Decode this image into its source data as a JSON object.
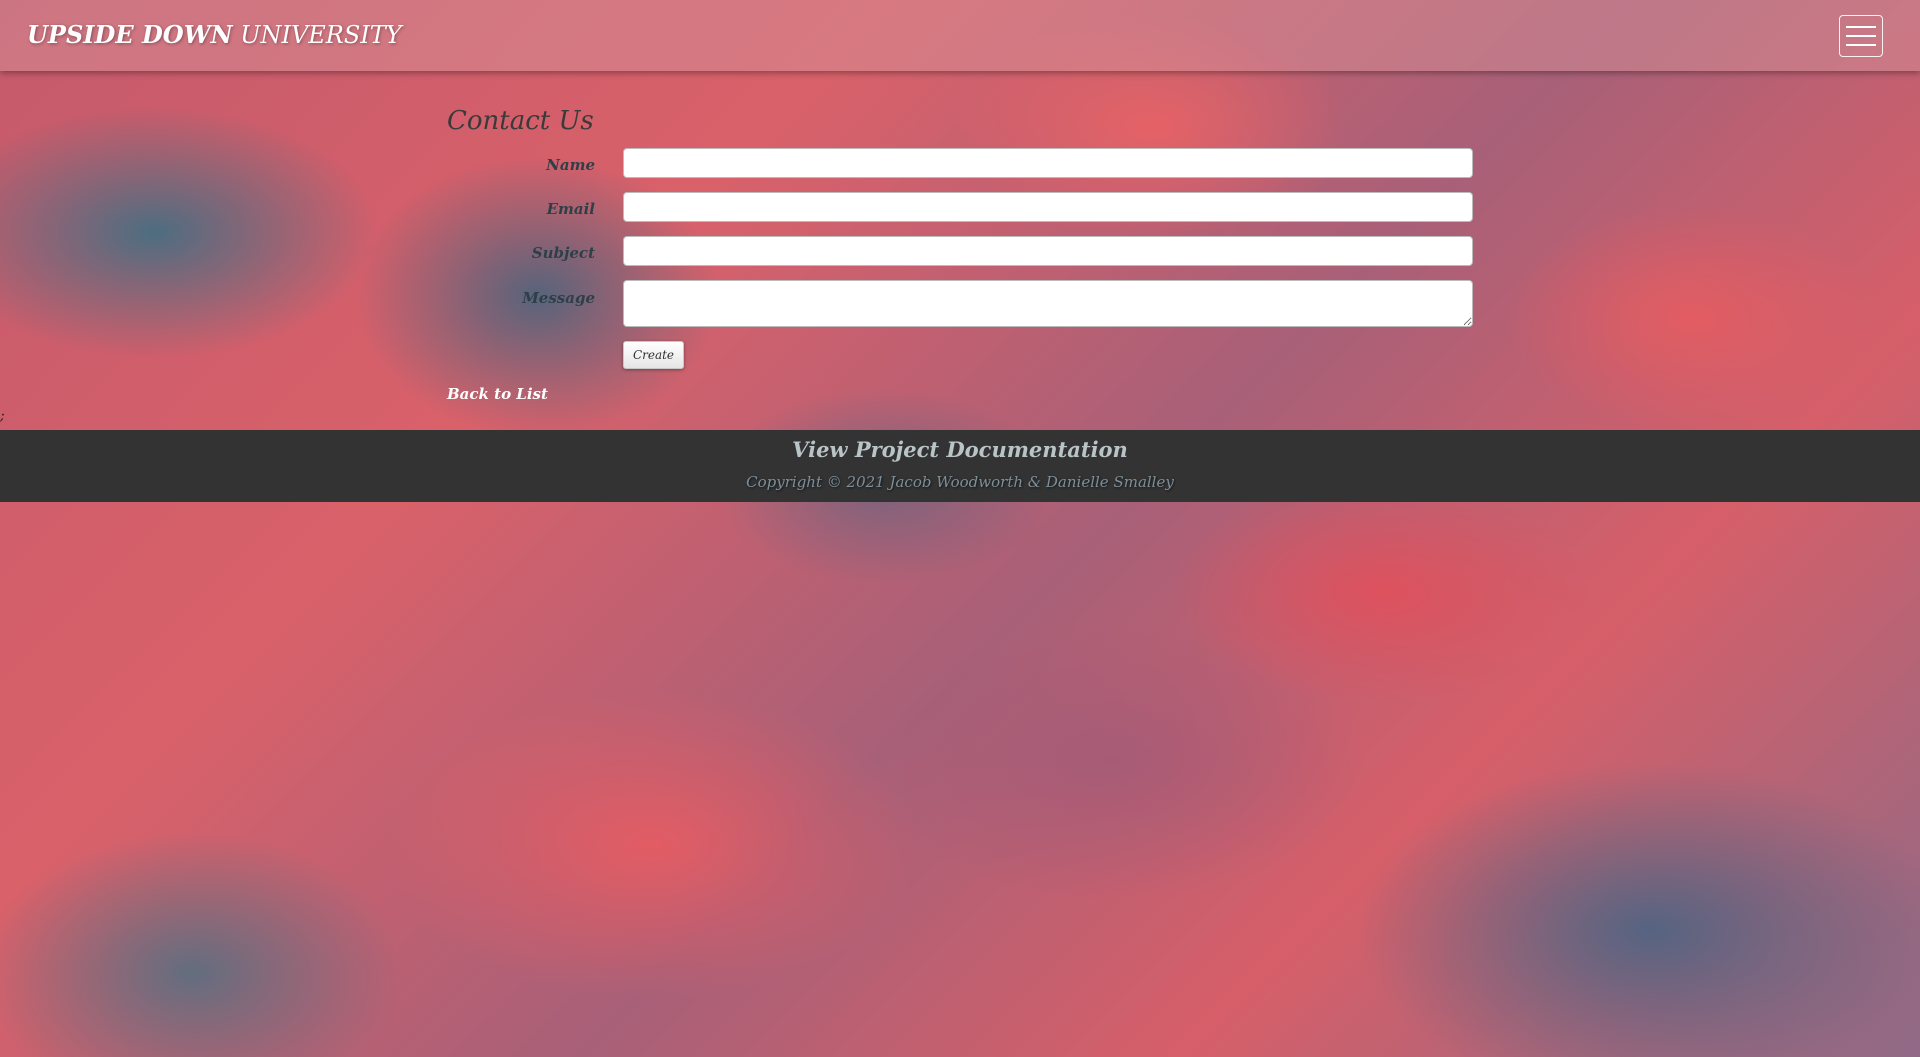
{
  "navbar": {
    "brand_bold": "UPSIDE DOWN",
    "brand_rest": "UNIVERSITY",
    "menu_icon": "hamburger-menu-icon"
  },
  "form": {
    "title": "Contact Us",
    "fields": {
      "name": {
        "label": "Name",
        "value": ""
      },
      "email": {
        "label": "Email",
        "value": ""
      },
      "subject": {
        "label": "Subject",
        "value": ""
      },
      "message": {
        "label": "Message",
        "value": ""
      }
    },
    "submit_label": "Create",
    "back_link": "Back to List"
  },
  "stray_text": ";",
  "footer": {
    "doc_link": "View Project Documentation",
    "copyright": "Copyright © 2021 Jacob Woodworth & Danielle Smalley"
  },
  "colors": {
    "footer_bg": "#333333",
    "label_text": "#2e3f48",
    "link_text": "#ffffff"
  }
}
